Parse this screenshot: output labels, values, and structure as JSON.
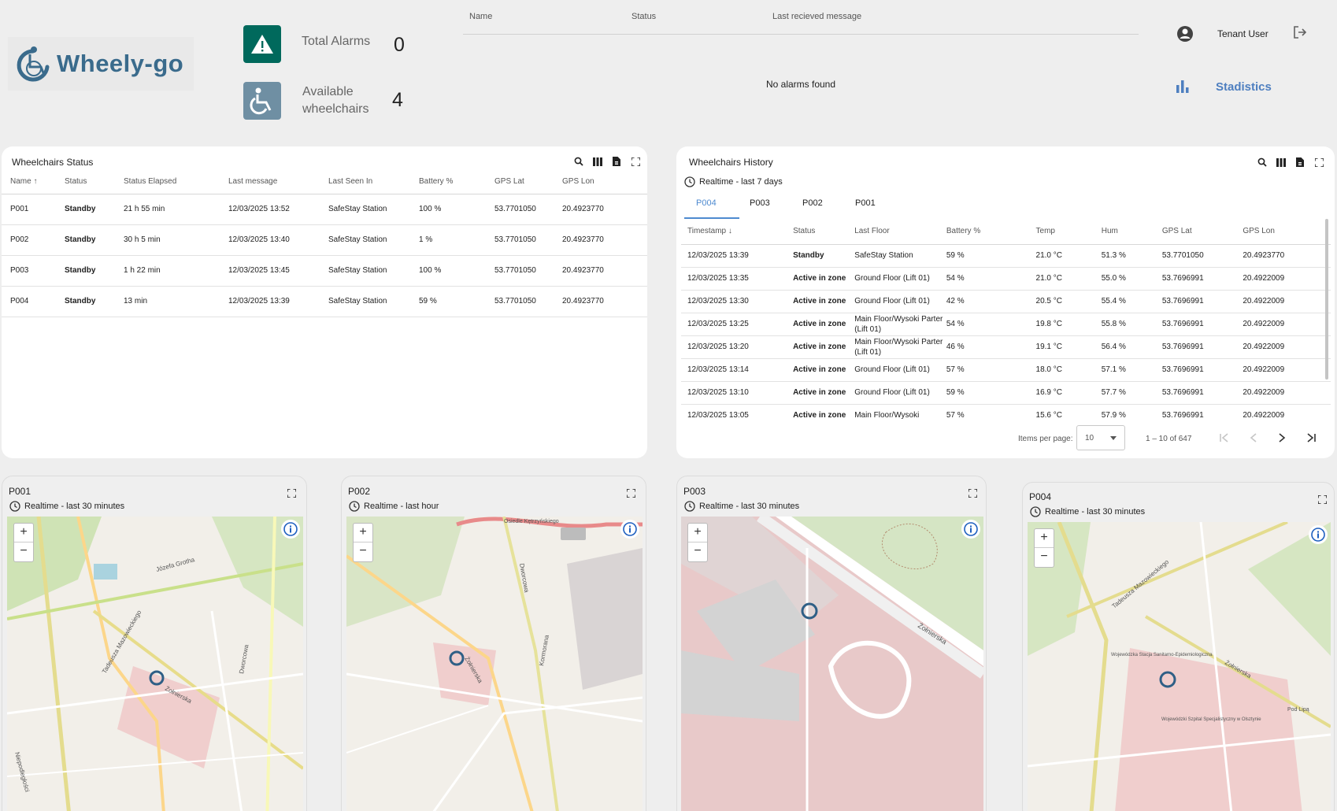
{
  "header": {
    "logo_text": "Wheely-go",
    "total_alarms_label": "Total Alarms",
    "total_alarms_value": "0",
    "available_label_1": "Available",
    "available_label_2": "wheelchairs",
    "available_value": "4",
    "alarm_cols": [
      "Name",
      "Status",
      "Last recieved message"
    ],
    "no_alarms": "No alarms found",
    "user_name": "Tenant User",
    "statistics_label": "Stadistics",
    "colors": {
      "alarm_icon_bg": "#00695c",
      "wheelchair_icon_bg": "#6f8fa3",
      "accent": "#4e7fc0"
    }
  },
  "status_widget": {
    "title": "Wheelchairs Status",
    "columns": [
      "Name",
      "Status",
      "Status Elapsed",
      "Last message",
      "Last Seen In",
      "Battery %",
      "GPS Lat",
      "GPS Lon"
    ],
    "rows": [
      [
        "P001",
        "Standby",
        "21 h 55 min",
        "12/03/2025 13:52",
        "SafeStay Station",
        "100 %",
        "53.7701050",
        "20.4923770"
      ],
      [
        "P002",
        "Standby",
        "30 h 5 min",
        "12/03/2025 13:40",
        "SafeStay Station",
        "1 %",
        "53.7701050",
        "20.4923770"
      ],
      [
        "P003",
        "Standby",
        "1 h 22 min",
        "12/03/2025 13:45",
        "SafeStay Station",
        "100 %",
        "53.7701050",
        "20.4923770"
      ],
      [
        "P004",
        "Standby",
        "13 min",
        "12/03/2025 13:39",
        "SafeStay Station",
        "59 %",
        "53.7701050",
        "20.4923770"
      ]
    ]
  },
  "history_widget": {
    "title": "Wheelchairs History",
    "subtitle": "Realtime - last 7 days",
    "tabs": [
      "P004",
      "P003",
      "P002",
      "P001"
    ],
    "columns": [
      "Timestamp",
      "Status",
      "Last Floor",
      "Battery %",
      "Temp",
      "Hum",
      "GPS Lat",
      "GPS Lon"
    ],
    "rows": [
      [
        "12/03/2025 13:39",
        "Standby",
        "SafeStay Station",
        "59 %",
        "21.0 °C",
        "51.3 %",
        "53.7701050",
        "20.4923770"
      ],
      [
        "12/03/2025 13:35",
        "Active in zone",
        "Ground Floor (Lift 01)",
        "54 %",
        "21.0 °C",
        "55.0 %",
        "53.7696991",
        "20.4922009"
      ],
      [
        "12/03/2025 13:30",
        "Active in zone",
        "Ground Floor (Lift 01)",
        "42 %",
        "20.5 °C",
        "55.4 %",
        "53.7696991",
        "20.4922009"
      ],
      [
        "12/03/2025 13:25",
        "Active in zone",
        "Main Floor/Wysoki Parter (Lift 01)",
        "54 %",
        "19.8 °C",
        "55.8 %",
        "53.7696991",
        "20.4922009"
      ],
      [
        "12/03/2025 13:20",
        "Active in zone",
        "Main Floor/Wysoki Parter (Lift 01)",
        "46 %",
        "19.1 °C",
        "56.4 %",
        "53.7696991",
        "20.4922009"
      ],
      [
        "12/03/2025 13:14",
        "Active in zone",
        "Ground Floor (Lift 01)",
        "57 %",
        "18.0 °C",
        "57.1 %",
        "53.7696991",
        "20.4922009"
      ],
      [
        "12/03/2025 13:10",
        "Active in zone",
        "Ground Floor (Lift 01)",
        "59 %",
        "16.9 °C",
        "57.7 %",
        "53.7696991",
        "20.4922009"
      ],
      [
        "12/03/2025 13:05",
        "Active in zone",
        "Main Floor/Wysoki",
        "57 %",
        "15.6 °C",
        "57.9 %",
        "53.7696991",
        "20.4922009"
      ]
    ],
    "items_per_page_label": "Items per page:",
    "items_per_page_value": "10",
    "range_label": "1 – 10 of 647"
  },
  "maps": [
    {
      "title": "P001",
      "subtitle": "Realtime - last 30 minutes"
    },
    {
      "title": "P002",
      "subtitle": "Realtime - last hour"
    },
    {
      "title": "P003",
      "subtitle": "Realtime - last 30 minutes"
    },
    {
      "title": "P004",
      "subtitle": "Realtime - last 30 minutes"
    }
  ],
  "map_labels": {
    "p001": [
      "Józefa Grotha",
      "Tadeusza Mazowieckiego",
      "Żołnierska",
      "Dworcowa",
      "Niepodległości"
    ],
    "p002": [
      "Osiedle Kętrzyńskiego",
      "Dworcowa",
      "Żołnierska",
      "Kormorana"
    ],
    "p003": [
      "Żołnierska"
    ],
    "p004": [
      "Tadeusza Mazowieckiego",
      "Żołnierska",
      "Wojewódzka Stacja Sanitarno-Epidemiologiczna",
      "Wojewódzki Szpital Specjalistyczny w Olsztynie",
      "Pod Lipą"
    ]
  },
  "zoom": {
    "in": "+",
    "out": "−"
  },
  "icons": [
    "warning-icon",
    "wheelchair-icon",
    "account-icon",
    "logout-icon",
    "bar-chart-icon",
    "search-icon",
    "columns-icon",
    "export-icon",
    "fullscreen-icon",
    "clock-icon",
    "info-icon",
    "wheelchair-marker-icon"
  ]
}
